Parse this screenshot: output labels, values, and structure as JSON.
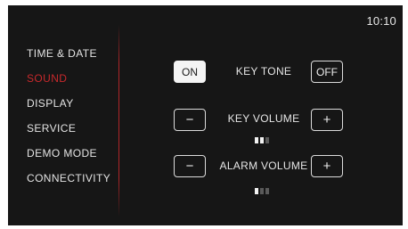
{
  "status_bar": {
    "time": "10:10"
  },
  "menu": {
    "items": [
      {
        "label": "TIME & DATE",
        "active": false
      },
      {
        "label": "SOUND",
        "active": true
      },
      {
        "label": "DISPLAY",
        "active": false
      },
      {
        "label": "SERVICE",
        "active": false
      },
      {
        "label": "DEMO MODE",
        "active": false
      },
      {
        "label": "CONNECTIVITY",
        "active": false
      }
    ]
  },
  "colors": {
    "background": "#161616",
    "accent": "#c8292c",
    "text": "#e4e4e4"
  },
  "sound": {
    "key_tone": {
      "label": "KEY TONE",
      "on_label": "ON",
      "off_label": "OFF",
      "selected": "ON"
    },
    "key_volume": {
      "label": "KEY VOLUME",
      "decrease_symbol": "−",
      "increase_symbol": "+",
      "level": 2,
      "max_level": 3
    },
    "alarm_volume": {
      "label": "ALARM VOLUME",
      "decrease_symbol": "−",
      "increase_symbol": "+",
      "level": 1,
      "max_level": 3
    }
  }
}
